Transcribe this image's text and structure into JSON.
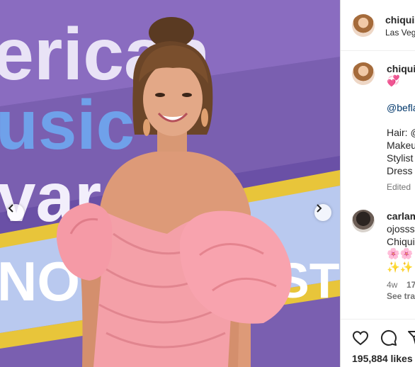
{
  "post": {
    "author": {
      "username": "chiquis",
      "location": "Las Vegas",
      "avatar": "profile-photo"
    },
    "caption": {
      "username": "chiquis",
      "emoji": "💞",
      "mention": "@befla",
      "credits": [
        "Hair: @",
        "Makeu",
        "Stylist",
        "Dress"
      ],
      "edited_label": "Edited"
    },
    "comment": {
      "username": "carlam",
      "lines": [
        "ojosss",
        "Chiqui"
      ],
      "emoji_line1": "🌸🌸",
      "emoji_line2": "✨✨",
      "time": "4w",
      "likes": "17",
      "see_translation": "See tra"
    },
    "actions": {
      "like_icon": "heart-icon",
      "comment_icon": "comment-icon",
      "share_icon": "share-icon"
    },
    "likes_text": "195,884 likes",
    "media": {
      "background_text": [
        "erican",
        "usic",
        "vard",
        "NOC",
        "STR"
      ],
      "prev_icon": "chevron-left-icon",
      "next_icon": "chevron-right-icon"
    },
    "colors": {
      "backdrop_purple": "#7a5fb0",
      "backdrop_yellow": "#e8c53a",
      "dress_pink": "#f4a0a8",
      "mention_blue": "#00376b",
      "muted_gray": "#737373"
    }
  }
}
